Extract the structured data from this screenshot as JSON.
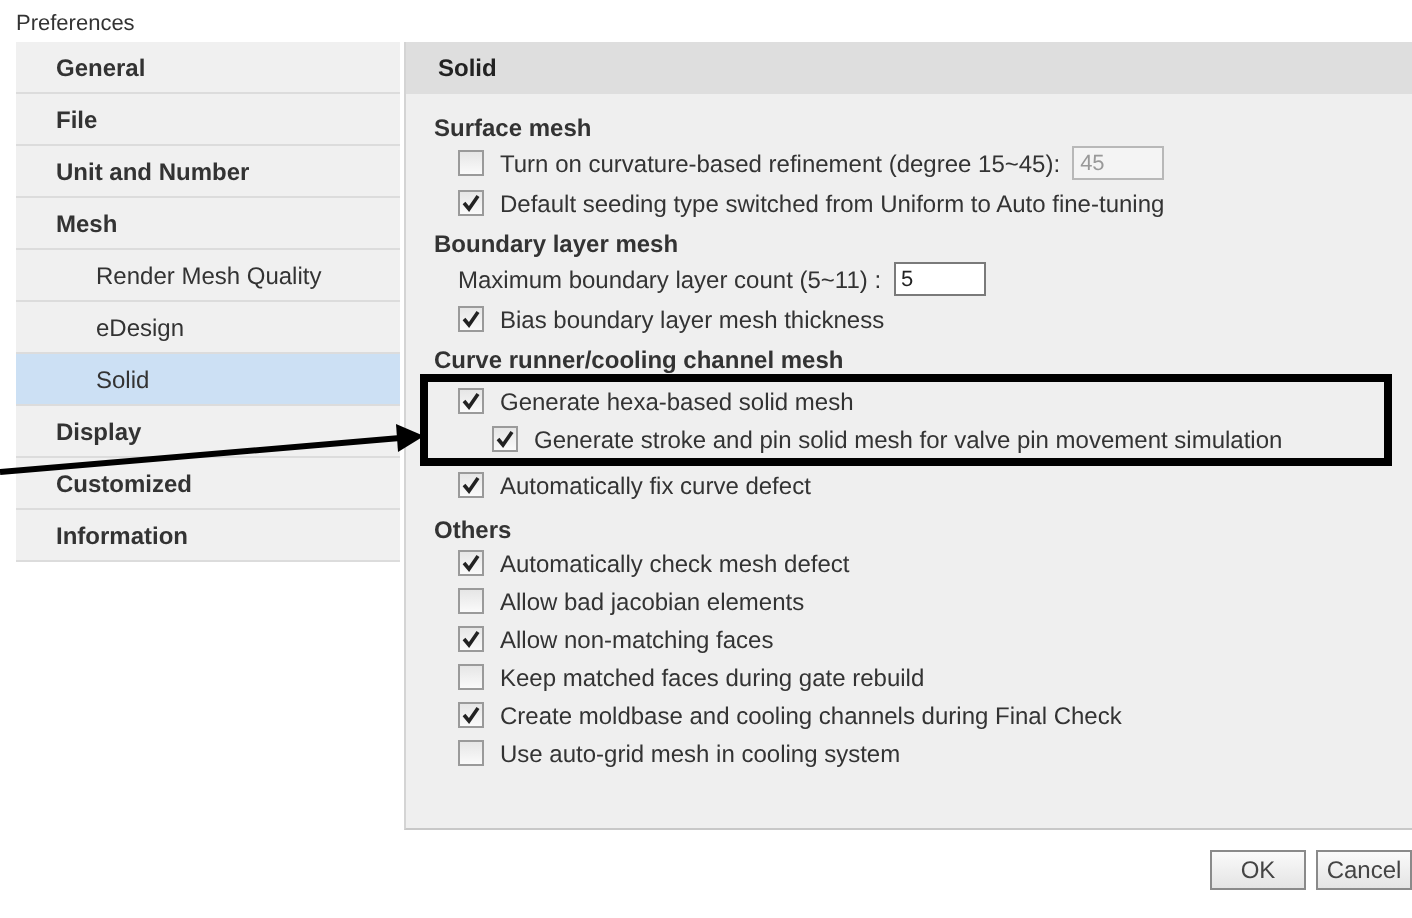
{
  "window": {
    "title": "Preferences"
  },
  "sidebar": {
    "items": [
      {
        "label": "General",
        "selected": false
      },
      {
        "label": "File",
        "selected": false
      },
      {
        "label": "Unit and Number",
        "selected": false
      },
      {
        "label": "Mesh",
        "selected": false,
        "children": [
          {
            "label": "Render Mesh Quality",
            "selected": false
          },
          {
            "label": "eDesign",
            "selected": false
          },
          {
            "label": "Solid",
            "selected": true
          }
        ]
      },
      {
        "label": "Display",
        "selected": false
      },
      {
        "label": "Customized",
        "selected": false
      },
      {
        "label": "Information",
        "selected": false
      }
    ]
  },
  "panel": {
    "title": "Solid",
    "sections": [
      {
        "title": "Surface mesh",
        "items": [
          {
            "kind": "checkbox",
            "label": "Turn on curvature-based refinement (degree 15~45):",
            "checked": false,
            "field": {
              "value": "45",
              "disabled": true
            },
            "highlighted": false
          },
          {
            "kind": "checkbox",
            "label": "Default seeding type switched from Uniform to Auto fine-tuning",
            "checked": true,
            "highlighted": false
          }
        ]
      },
      {
        "title": "Boundary layer mesh",
        "items": [
          {
            "kind": "field",
            "label": "Maximum boundary layer count (5~11) :",
            "field": {
              "value": "5",
              "disabled": false
            },
            "highlighted": false
          },
          {
            "kind": "checkbox",
            "label": "Bias boundary layer mesh thickness",
            "checked": true,
            "highlighted": false
          }
        ]
      },
      {
        "title": "Curve runner/cooling channel mesh",
        "items": [
          {
            "kind": "checkbox",
            "label": "Generate hexa-based solid mesh",
            "checked": true,
            "highlighted": true,
            "children": [
              {
                "kind": "checkbox",
                "label": "Generate stroke and pin solid mesh for valve pin movement simulation",
                "checked": true
              }
            ]
          },
          {
            "kind": "checkbox",
            "label": "Automatically fix curve defect",
            "checked": true,
            "highlighted": false
          }
        ]
      },
      {
        "title": "Others",
        "items": [
          {
            "kind": "checkbox",
            "label": "Automatically check mesh defect",
            "checked": true,
            "highlighted": false
          },
          {
            "kind": "checkbox",
            "label": "Allow bad jacobian elements",
            "checked": false,
            "highlighted": false
          },
          {
            "kind": "checkbox",
            "label": "Allow non-matching faces",
            "checked": true,
            "highlighted": false
          },
          {
            "kind": "checkbox",
            "label": "Keep matched faces during gate rebuild",
            "checked": false,
            "highlighted": false
          },
          {
            "kind": "checkbox",
            "label": "Create moldbase and cooling channels during Final Check",
            "checked": true,
            "highlighted": false
          },
          {
            "kind": "checkbox",
            "label": "Use auto-grid mesh in cooling system",
            "checked": false,
            "highlighted": false
          }
        ]
      }
    ]
  },
  "buttons": [
    "OK",
    "Cancel"
  ]
}
